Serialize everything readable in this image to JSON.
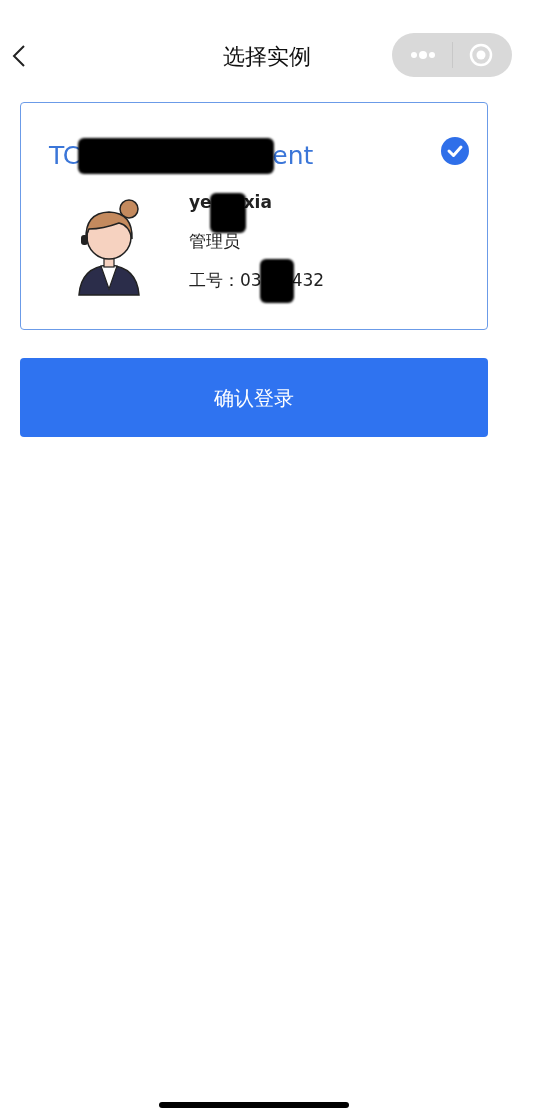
{
  "header": {
    "title": "选择实例"
  },
  "instances": [
    {
      "title": [
        "TC",
        "ent"
      ],
      "name": [
        "ye",
        "xia"
      ],
      "role": "管理员",
      "id_label": "工号：",
      "id": [
        "03",
        "432"
      ],
      "selected": true
    }
  ],
  "confirm_button": "确认登录"
}
